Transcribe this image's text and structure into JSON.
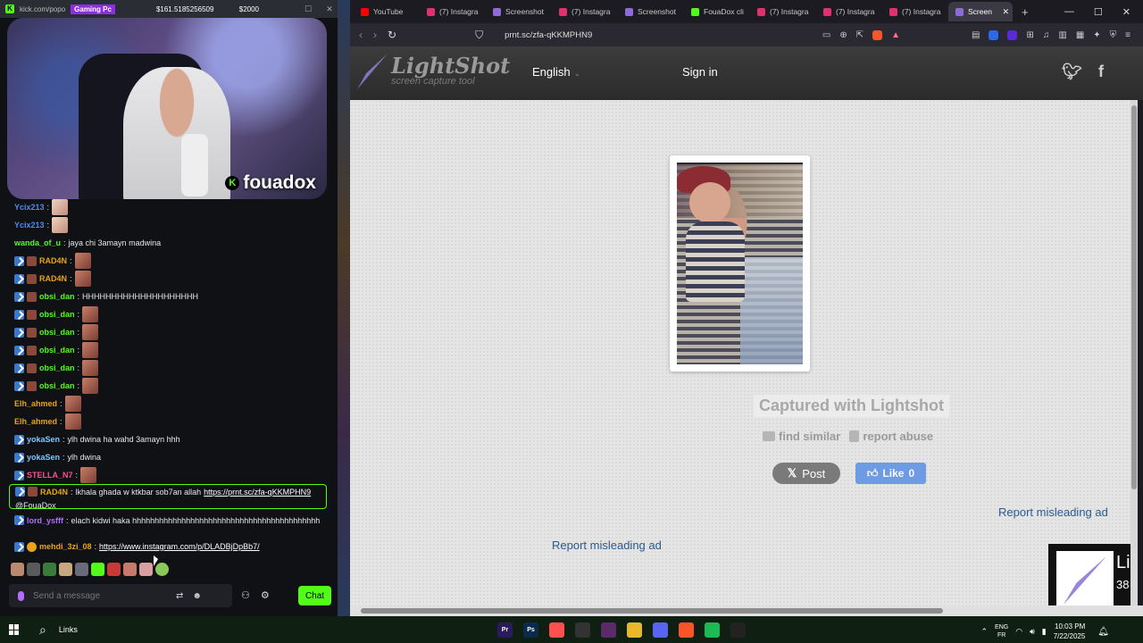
{
  "kick": {
    "title_url": "kick.com/popo",
    "title_tag": "Gaming Pc",
    "title_amount": "$161.5185256509",
    "title_goal": "$2000",
    "streamer": "fouadox",
    "send_placeholder": "Send a message",
    "chat_button": "Chat"
  },
  "chat": [
    {
      "user": "Ycix213",
      "color": "#4f8ce8",
      "badges": [],
      "text": "",
      "emote": "hand"
    },
    {
      "user": "Ycix213",
      "color": "#4f8ce8",
      "badges": [],
      "text": "",
      "emote": "hand"
    },
    {
      "user": "wanda_of_u",
      "color": "#53fc18",
      "badges": [],
      "text": "jaya chi 3amayn madwina",
      "emote": ""
    },
    {
      "user": "RAD4N",
      "color": "#e8a317",
      "badges": [
        "verified",
        "sub"
      ],
      "text": "",
      "emote": "face"
    },
    {
      "user": "RAD4N",
      "color": "#e8a317",
      "badges": [
        "verified",
        "sub"
      ],
      "text": "",
      "emote": "face"
    },
    {
      "user": "obsi_dan",
      "color": "#53fc18",
      "badges": [
        "verified",
        "sub"
      ],
      "text": "HHHHHHHHHHHHHHHHHHHH",
      "emote": ""
    },
    {
      "user": "obsi_dan",
      "color": "#53fc18",
      "badges": [
        "verified",
        "sub"
      ],
      "text": "",
      "emote": "face"
    },
    {
      "user": "obsi_dan",
      "color": "#53fc18",
      "badges": [
        "verified",
        "sub"
      ],
      "text": "",
      "emote": "face"
    },
    {
      "user": "obsi_dan",
      "color": "#53fc18",
      "badges": [
        "verified",
        "sub"
      ],
      "text": "",
      "emote": "face"
    },
    {
      "user": "obsi_dan",
      "color": "#53fc18",
      "badges": [
        "verified",
        "sub"
      ],
      "text": "",
      "emote": "face"
    },
    {
      "user": "obsi_dan",
      "color": "#53fc18",
      "badges": [
        "verified",
        "sub"
      ],
      "text": "",
      "emote": "face"
    },
    {
      "user": "Elh_ahmed",
      "color": "#e8a317",
      "badges": [],
      "text": "",
      "emote": "face"
    },
    {
      "user": "Elh_ahmed",
      "color": "#e8a317",
      "badges": [],
      "text": "",
      "emote": "face"
    },
    {
      "user": "yokaSen",
      "color": "#7ec8ff",
      "badges": [
        "verified"
      ],
      "text": "ylh dwina ha wahd 3amayn hhh",
      "emote": ""
    },
    {
      "user": "yokaSen",
      "color": "#7ec8ff",
      "badges": [
        "verified"
      ],
      "text": "ylh dwina",
      "emote": ""
    },
    {
      "user": "STELLA_N7",
      "color": "#ff4f8f",
      "badges": [
        "verified"
      ],
      "text": "",
      "emote": "face"
    }
  ],
  "highlight_msg": {
    "user": "RAD4N",
    "text": "lkhala ghada w ktkbar sob7an allah",
    "link": "https://prnt.sc/zfa-qKKMPHN9",
    "mention": "@FouaDox"
  },
  "msg_lord": {
    "user": "lord_ysfff",
    "text": "elach kidwi haka hhhhhhhhhhhhhhhhhhhhhhhhhhhhhhhhhhhhhhhhhh"
  },
  "msg_mehdi": {
    "user": "mehdi_3zi_08",
    "link": "https://www.instagram.com/p/DLADBjDpBb7/"
  },
  "browser": {
    "tabs": [
      {
        "label": "YouTube",
        "color": "#ff0000"
      },
      {
        "label": "(7) Instagra",
        "color": "#e1306c"
      },
      {
        "label": "Screenshot",
        "color": "#8e6bd8"
      },
      {
        "label": "(7) Instagra",
        "color": "#e1306c"
      },
      {
        "label": "Screenshot",
        "color": "#8e6bd8"
      },
      {
        "label": "FouaDox cli",
        "color": "#53fc18"
      },
      {
        "label": "(7) Instagra",
        "color": "#e1306c"
      },
      {
        "label": "(7) Instagra",
        "color": "#e1306c"
      },
      {
        "label": "(7) Instagra",
        "color": "#e1306c"
      },
      {
        "label": "Screen",
        "color": "#8e6bd8"
      }
    ],
    "url": "prnt.sc/zfa-qKKMPHN9"
  },
  "lightshot": {
    "brand": "LightShot",
    "tagline": "screen capture tool",
    "language": "English",
    "signin": "Sign in",
    "captured": "Captured with Lightshot",
    "find_similar": "find similar",
    "report_abuse": "report abuse",
    "post": "Post",
    "like": "Like",
    "like_count": "0",
    "report_ad": "Report misleading ad",
    "ad_text": "Li",
    "ad_num": "38"
  },
  "taskbar": {
    "links": "Links",
    "lang_top": "ENG",
    "lang_bottom": "FR",
    "time": "10:03 PM",
    "date": "7/22/2025",
    "apps": [
      {
        "label": "Pr",
        "color": "#2a1a5e"
      },
      {
        "label": "Ps",
        "color": "#0b2b4d"
      },
      {
        "label": "",
        "color": "#ff4f4f"
      },
      {
        "label": "",
        "color": "#333"
      },
      {
        "label": "",
        "color": "#5a2a6a"
      },
      {
        "label": "",
        "color": "#e8b82a"
      },
      {
        "label": "",
        "color": "#5865f2"
      },
      {
        "label": "",
        "color": "#fb542b"
      },
      {
        "label": "",
        "color": "#1db954"
      },
      {
        "label": "",
        "color": "#222"
      }
    ]
  }
}
